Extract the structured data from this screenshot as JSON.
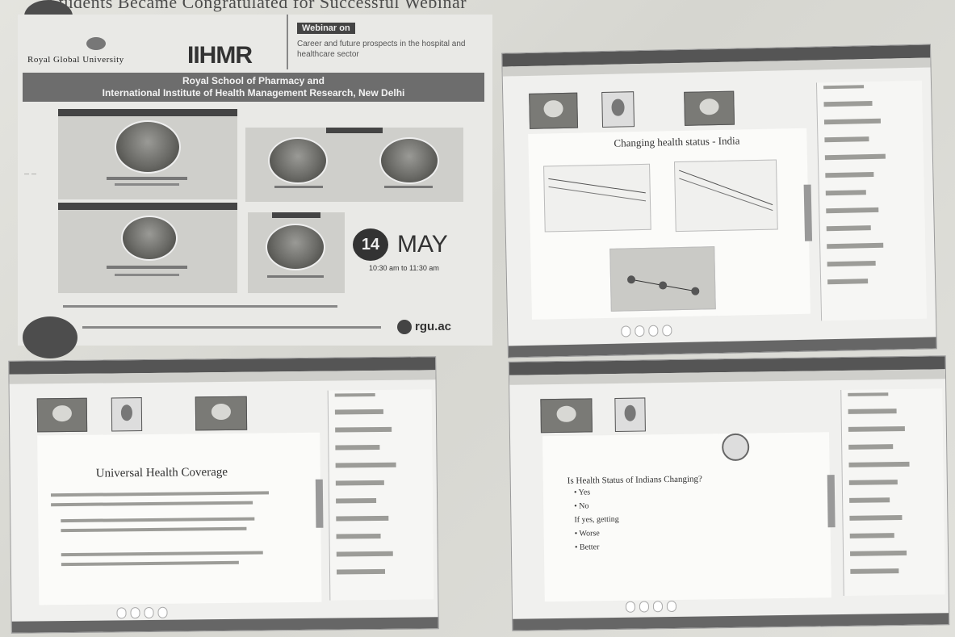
{
  "headline": "Students Became Congratulated for Successful Webinar",
  "poster": {
    "university": "Royal Global University",
    "partner": "IIHMR",
    "webinar_tag": "Webinar on",
    "topic": "Career and future prospects in the hospital and healthcare sector",
    "banner_line1": "Royal School of Pharmacy and",
    "banner_line2": "International Institute of Health Management Research, New Delhi",
    "day": "14",
    "month": "MAY",
    "time": "10:30 am to 11:30 am",
    "site": "rgu.ac"
  },
  "shot_top_right": {
    "slide_title": "Changing health status - India"
  },
  "shot_bottom_left": {
    "slide_title": "Universal Health Coverage"
  },
  "shot_bottom_right": {
    "slide_title": "Is Health Status of Indians Changing?",
    "options": [
      "Yes",
      "No"
    ],
    "followup": "If yes, getting",
    "sub_options": [
      "Worse",
      "Better"
    ]
  }
}
